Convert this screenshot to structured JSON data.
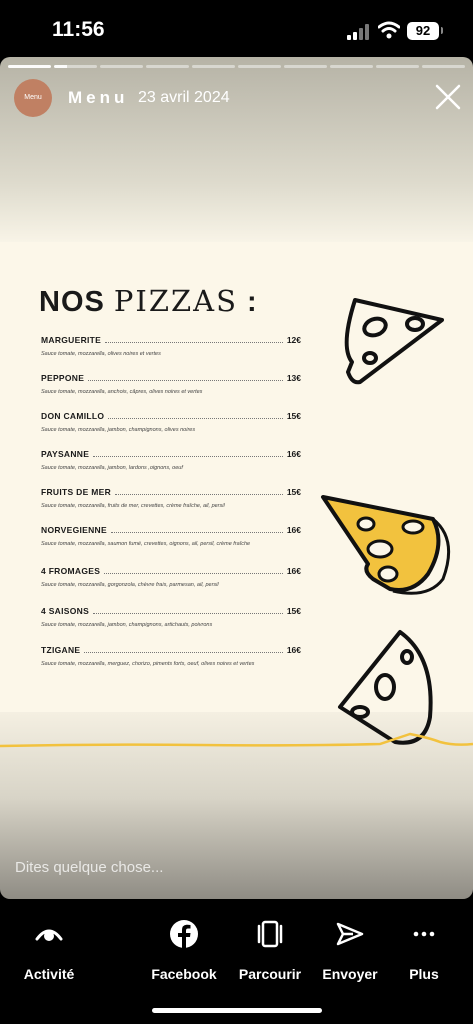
{
  "status_bar": {
    "time": "11:56",
    "battery": "92"
  },
  "story": {
    "title": "Menu",
    "date": "23 avril 2024",
    "avatar_text": "Menu",
    "reply_placeholder": "Dites quelque chose..."
  },
  "menu": {
    "heading_part1": "NOS ",
    "heading_part2": "PIZZAS",
    "heading_part3": " :",
    "items": [
      {
        "name": "MARGUERITE",
        "price": "12€",
        "desc": "Sauce tomate, mozzarella, olives noires et vertes"
      },
      {
        "name": "PEPPONE",
        "price": "13€",
        "desc": "Sauce tomate, mozzarella, anchois, câpres, olives noires et vertes"
      },
      {
        "name": "DON CAMILLO",
        "price": "15€",
        "desc": "Sauce tomate, mozzarella, jambon, champignons, olives noires"
      },
      {
        "name": "PAYSANNE",
        "price": "16€",
        "desc": "Sauce tomate, mozzarella, jambon, lardons ,oignons, oeuf"
      },
      {
        "name": "FRUITS DE MER",
        "price": "15€",
        "desc": "Sauce tomate, mozzarella, fruits de mer, crevettes, crème fraîche, ail, persil"
      },
      {
        "name": "NORVEGIENNE",
        "price": "16€",
        "desc": "Sauce tomate, mozzarella, saumon fumé, crevettes, oignons, ail, persil, crème fraîche"
      },
      {
        "name": "4 FROMAGES",
        "price": "16€",
        "desc": "Sauce tomate, mozzarella, gorgonzola, chèvre frais, parmesan, ail, persil"
      },
      {
        "name": "4 SAISONS",
        "price": "15€",
        "desc": "Sauce tomate, mozzarella, jambon, champignons, artichauts, poivrons"
      },
      {
        "name": "TZIGANE",
        "price": "16€",
        "desc": "Sauce tomate, mozzarella, merguez, chorizo, piments forts, oeuf, olives noires et vertes"
      }
    ]
  },
  "actions": [
    {
      "label": "Activité",
      "icon": "activity-eye-icon"
    },
    {
      "label": "Facebook",
      "icon": "facebook-icon"
    },
    {
      "label": "Parcourir",
      "icon": "browse-icon"
    },
    {
      "label": "Envoyer",
      "icon": "send-icon"
    },
    {
      "label": "Plus",
      "icon": "more-icon"
    }
  ],
  "colors": {
    "accent_yellow": "#f2c23e",
    "background_cream": "#fcf7e9",
    "avatar": "#c08063"
  }
}
